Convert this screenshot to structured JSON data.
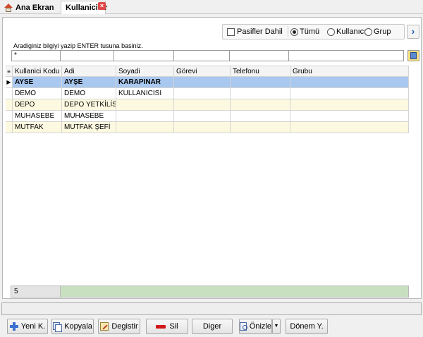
{
  "tabs": [
    {
      "label": "Ana Ekran"
    },
    {
      "label": "Kullanicilar"
    }
  ],
  "filters": {
    "passive_label": "Pasifler Dahil",
    "passive_checked": false,
    "scope_options": [
      "Tümü",
      "Kullanıcı",
      "Grup"
    ],
    "scope_selected": "Tümü"
  },
  "search": {
    "hint": "Aradiginiz bilgiyi yazip ENTER tusuna basiniz.",
    "value": "*"
  },
  "grid": {
    "columns": [
      "Kullanici Kodu",
      "Adi",
      "Soyadi",
      "Görevi",
      "Telefonu",
      "Grubu"
    ],
    "rows": [
      {
        "code": "AYSE",
        "name": "AYŞE",
        "surname": "KARAPINAR",
        "duty": "",
        "phone": "",
        "group": ""
      },
      {
        "code": "DEMO",
        "name": "DEMO",
        "surname": "KULLANICISI",
        "duty": "",
        "phone": "",
        "group": ""
      },
      {
        "code": "DEPO",
        "name": "DEPO YETKİLİSİ",
        "surname": "",
        "duty": "",
        "phone": "",
        "group": ""
      },
      {
        "code": "MUHASEBE",
        "name": "MUHASEBE",
        "surname": "",
        "duty": "",
        "phone": "",
        "group": ""
      },
      {
        "code": "MUTFAK",
        "name": "MUTFAK ŞEFİ",
        "surname": "",
        "duty": "",
        "phone": "",
        "group": ""
      }
    ],
    "record_count": "5"
  },
  "toolbar": {
    "new_label": "Yeni K.",
    "copy_label": "Kopyala",
    "edit_label": "Degistir",
    "delete_label": "Sil",
    "other_label": "Diger",
    "preview_label": "Önizle",
    "period_label": "Dönem Y."
  }
}
